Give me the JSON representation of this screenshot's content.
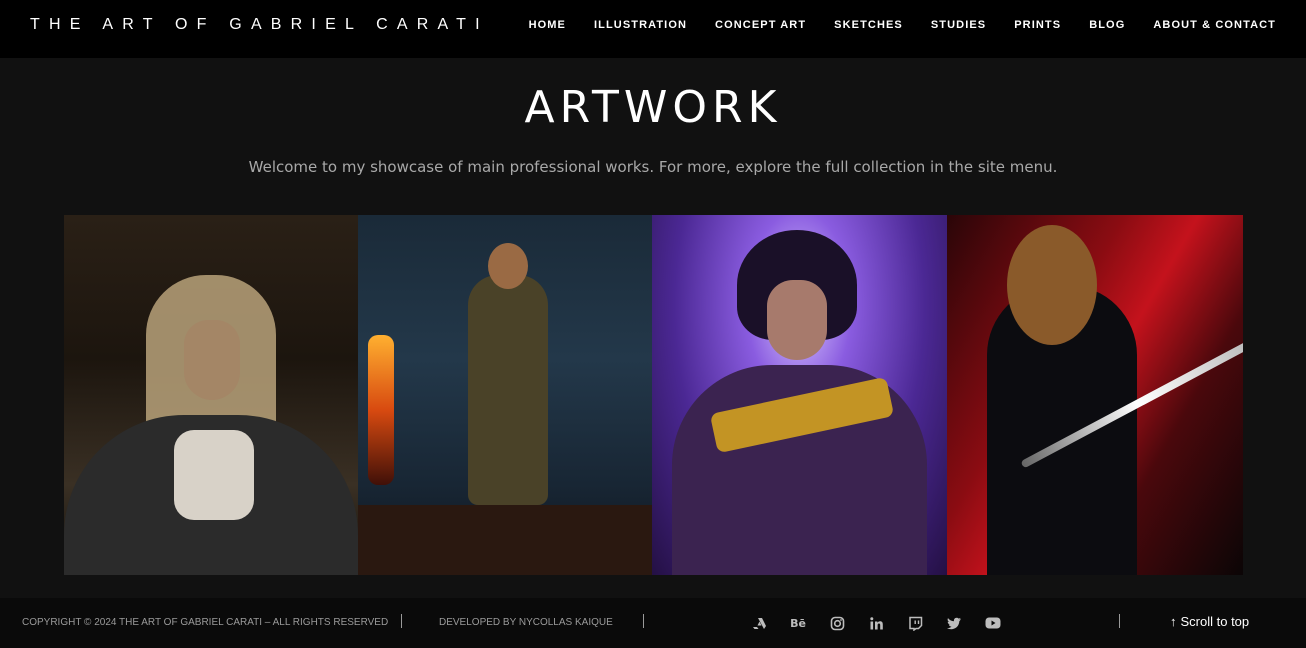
{
  "header": {
    "brand": "THE ART OF GABRIEL CARATI",
    "nav": [
      "HOME",
      "ILLUSTRATION",
      "CONCEPT ART",
      "SKETCHES",
      "STUDIES",
      "PRINTS",
      "BLOG",
      "ABOUT & CONTACT"
    ]
  },
  "main": {
    "title": "ARTWORK",
    "subtitle": "Welcome to my showcase of main professional works. For more, explore the full collection in the site menu."
  },
  "gallery": {
    "items": [
      "artwork-1",
      "artwork-2",
      "artwork-3",
      "artwork-4"
    ]
  },
  "footer": {
    "copyright": "COPYRIGHT © 2024 THE ART OF GABRIEL CARATI – ALL RIGHTS RESERVED",
    "separator": "|",
    "developer": "DEVELOPED BY NYCOLLAS KAIQUE",
    "social_icons": [
      "artstation-icon",
      "behance-icon",
      "instagram-icon",
      "linkedin-icon",
      "twitch-icon",
      "twitter-icon",
      "youtube-icon"
    ],
    "behance_glyph": "Bē",
    "scroll_to_top": "Scroll to top",
    "scroll_arrow": "↑"
  },
  "colors": {
    "background": "#111111",
    "header_bg": "#000000",
    "footer_bg": "#0a0a0a",
    "subtitle_text": "#a8a8a8"
  }
}
